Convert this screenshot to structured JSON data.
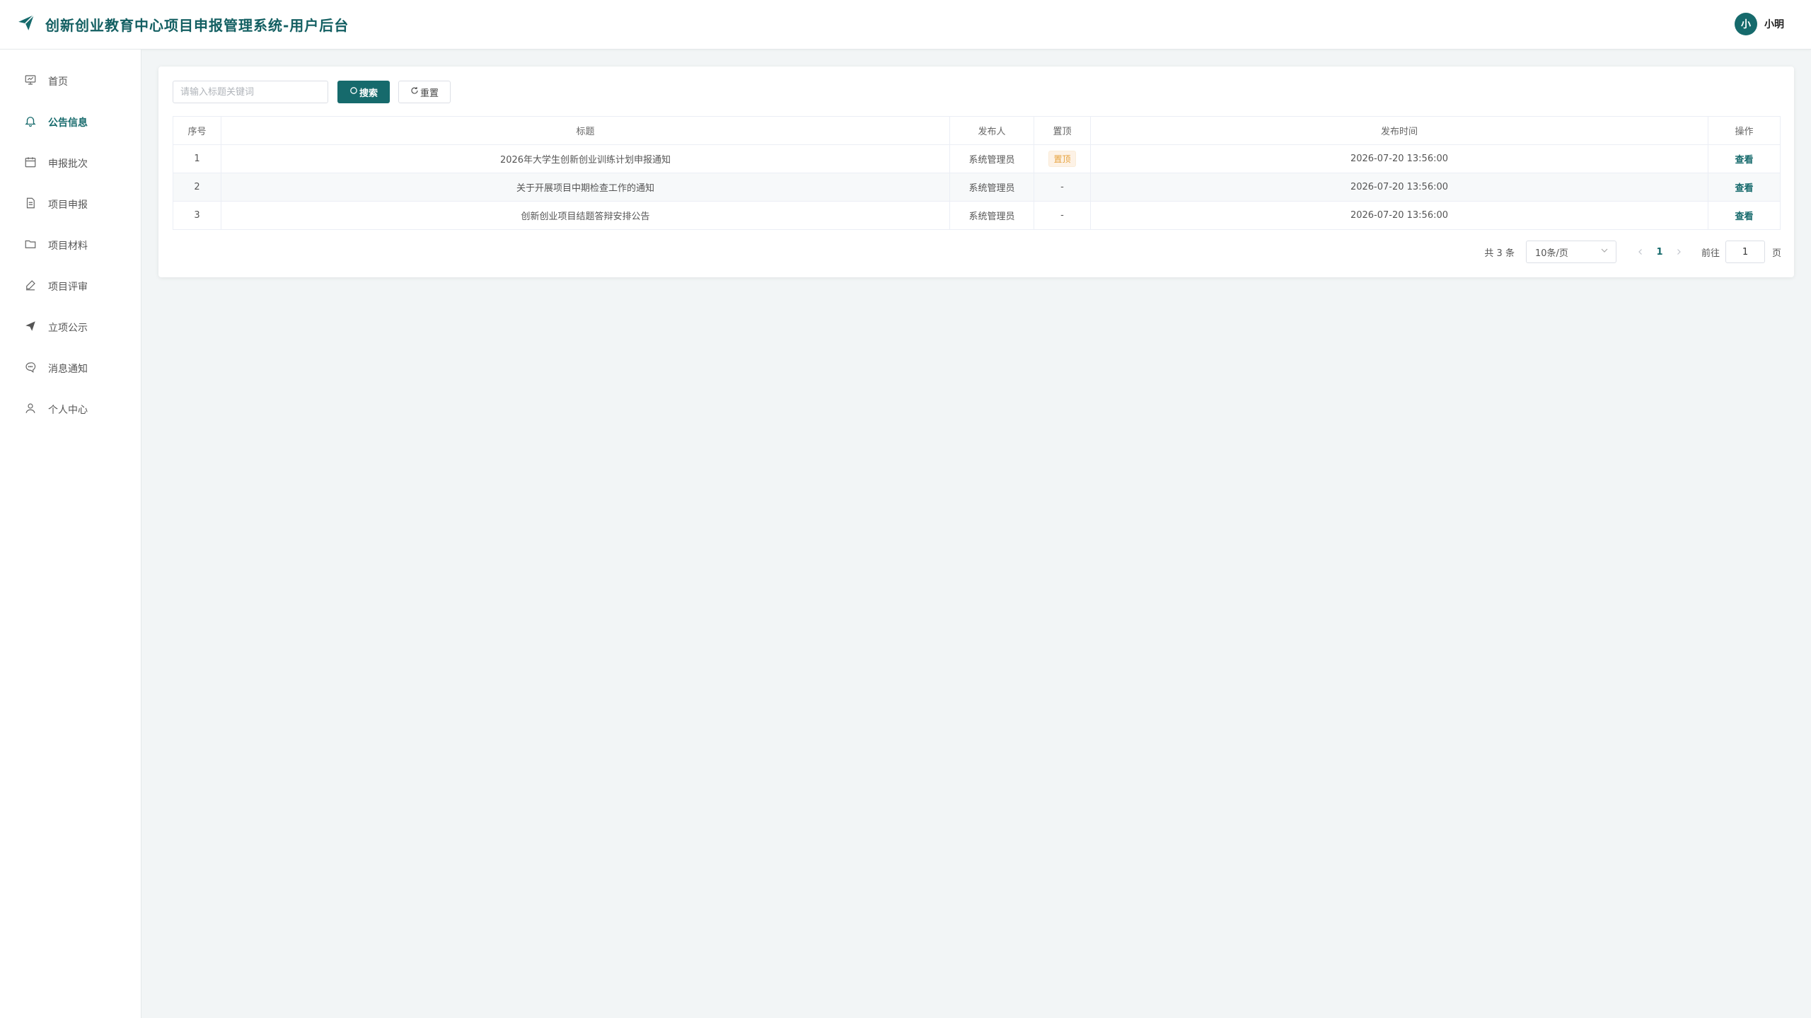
{
  "header": {
    "title": "创新创业教育中心项目申报管理系统-用户后台",
    "avatar_text": "小",
    "username": "小明",
    "brand_color": "#166a6c"
  },
  "sidebar": {
    "items": [
      {
        "label": "首页",
        "icon": "dashboard-icon"
      },
      {
        "label": "公告信息",
        "icon": "bell-icon",
        "active": true
      },
      {
        "label": "申报批次",
        "icon": "calendar-icon"
      },
      {
        "label": "项目申报",
        "icon": "document-icon"
      },
      {
        "label": "项目材料",
        "icon": "folder-icon"
      },
      {
        "label": "项目评审",
        "icon": "pen-icon"
      },
      {
        "label": "立项公示",
        "icon": "paper-plane-icon"
      },
      {
        "label": "消息通知",
        "icon": "chat-icon"
      },
      {
        "label": "个人中心",
        "icon": "user-icon"
      }
    ]
  },
  "toolbar": {
    "search_placeholder": "请输入标题关键词",
    "search_label": "搜索",
    "reset_label": "重置"
  },
  "table": {
    "columns": [
      "序号",
      "标题",
      "发布人",
      "置顶",
      "发布时间",
      "操作"
    ],
    "rows": [
      {
        "no": "1",
        "title": "2026年大学生创新创业训练计划申报通知",
        "publisher": "系统管理员",
        "pinned": "置顶",
        "time": "2026-07-20 13:56:00",
        "action": "查看"
      },
      {
        "no": "2",
        "title": "关于开展项目中期检查工作的通知",
        "publisher": "系统管理员",
        "pinned": "-",
        "time": "2026-07-20 13:56:00",
        "action": "查看"
      },
      {
        "no": "3",
        "title": "创新创业项目结题答辩安排公告",
        "publisher": "系统管理员",
        "pinned": "-",
        "time": "2026-07-20 13:56:00",
        "action": "查看"
      }
    ]
  },
  "pagination": {
    "total_text": "共 3 条",
    "page_size": "10条/页",
    "current_page": "1",
    "goto_label": "前往",
    "goto_value": "1",
    "page_suffix": "页"
  }
}
